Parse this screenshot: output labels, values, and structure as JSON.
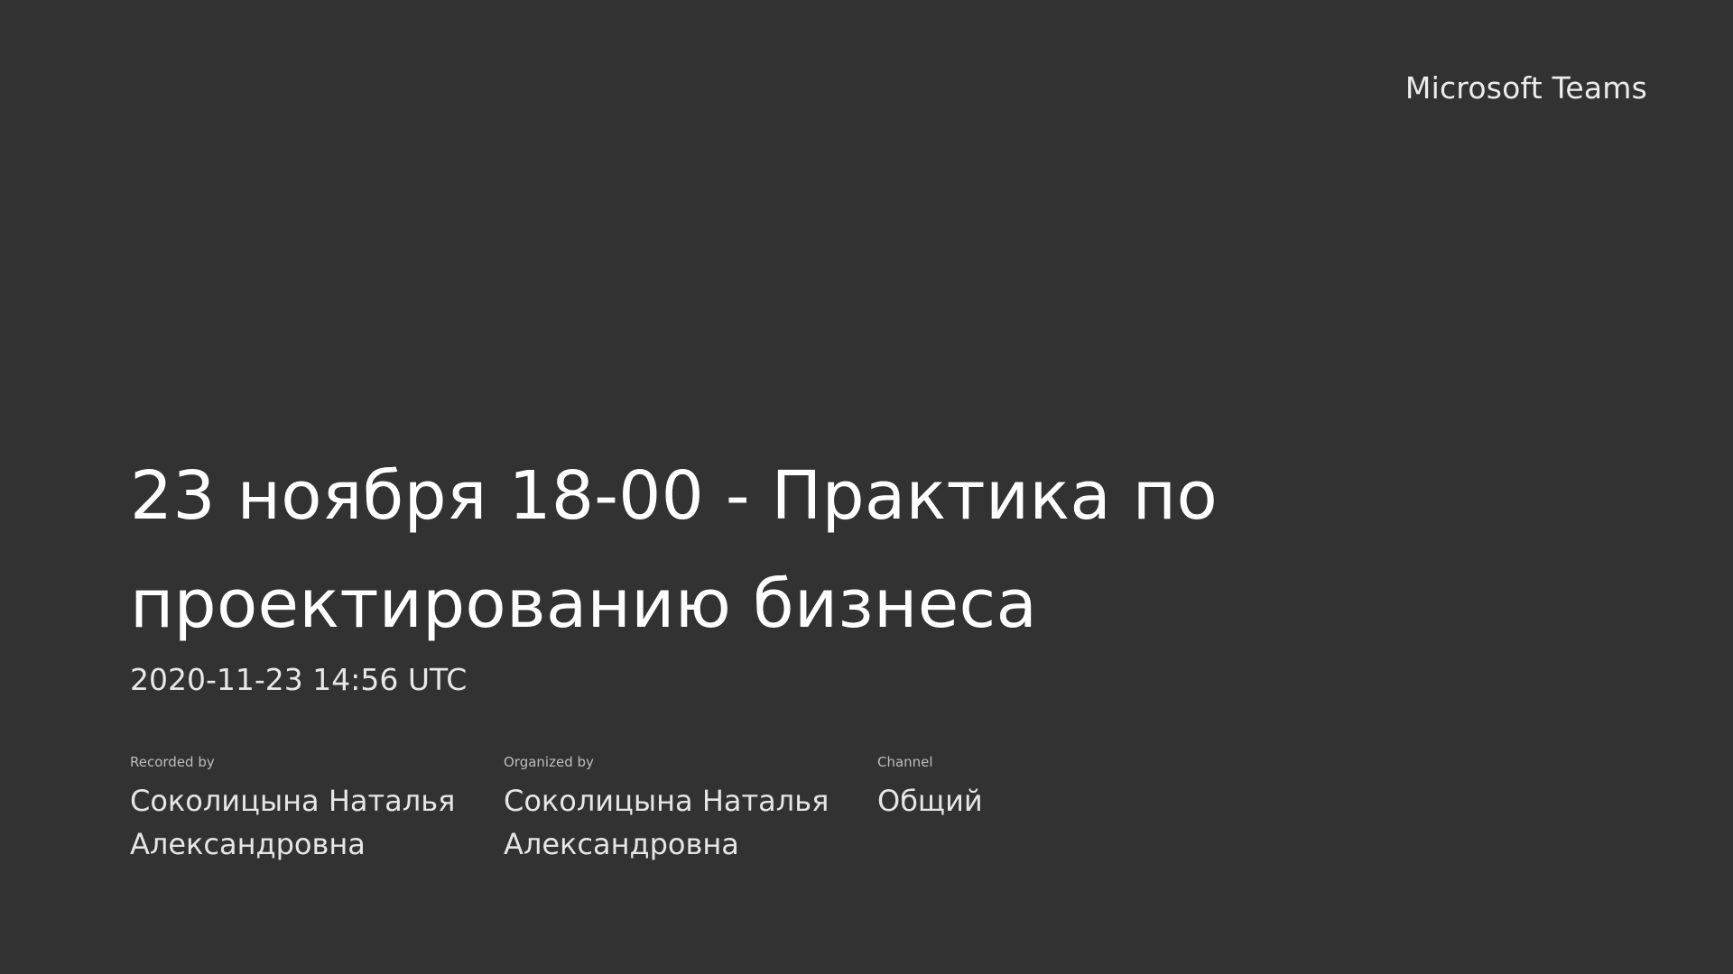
{
  "brand": "Microsoft Teams",
  "recording": {
    "title": "23 ноября 18-00 - Практика по проектированию бизнеса",
    "timestamp": "2020-11-23 14:56 UTC"
  },
  "meta": {
    "recorded_by_label": "Recorded by",
    "recorded_by_value": "Соколицына Наталья Александровна",
    "organized_by_label": "Organized by",
    "organized_by_value": "Соколицына Наталья Александровна",
    "channel_label": "Channel",
    "channel_value": "Общий"
  },
  "colors": {
    "background": "#323232",
    "text": "#ffffff"
  }
}
